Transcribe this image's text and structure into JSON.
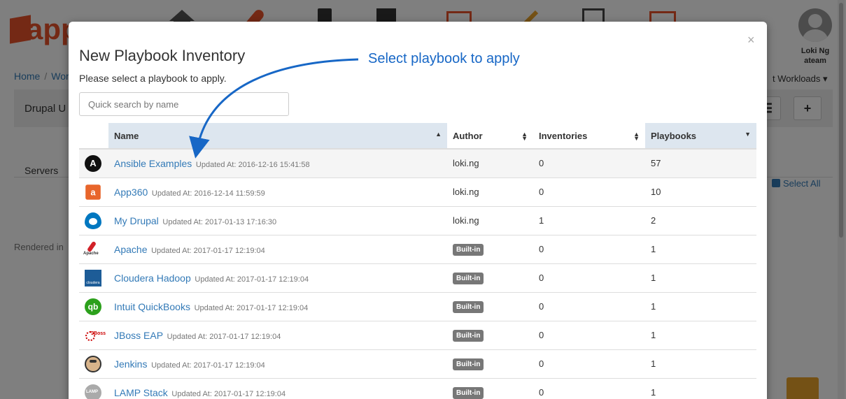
{
  "background": {
    "logo_text": "app",
    "user_name": "Loki Ng",
    "user_team": "ateam",
    "breadcrumb": [
      "Home",
      "Wor"
    ],
    "bar_title": "Drupal U",
    "workloads_label": "t Workloads",
    "list_button": "☰",
    "add_button": "+",
    "servers_label": "Servers",
    "select_all": "Select All",
    "rendered_text": "Rendered in"
  },
  "modal": {
    "close": "×",
    "title": "New Playbook Inventory",
    "subtitle": "Please select a playbook to apply.",
    "search_placeholder": "Quick search by name",
    "columns": {
      "name": "Name",
      "author": "Author",
      "inventories": "Inventories",
      "playbooks": "Playbooks"
    },
    "rows": [
      {
        "icon": "ansible-icon",
        "name": "Ansible Examples",
        "updated": "Updated At: 2016-12-16 15:41:58",
        "author": "loki.ng",
        "builtin": false,
        "inventories": "0",
        "playbooks": "57"
      },
      {
        "icon": "app360-icon",
        "name": "App360",
        "updated": "Updated At: 2016-12-14 11:59:59",
        "author": "loki.ng",
        "builtin": false,
        "inventories": "0",
        "playbooks": "10"
      },
      {
        "icon": "drupal-icon",
        "name": "My Drupal",
        "updated": "Updated At: 2017-01-13 17:16:30",
        "author": "loki.ng",
        "builtin": false,
        "inventories": "1",
        "playbooks": "2"
      },
      {
        "icon": "apache-icon",
        "name": "Apache",
        "updated": "Updated At: 2017-01-17 12:19:04",
        "author": "Built-in",
        "builtin": true,
        "inventories": "0",
        "playbooks": "1"
      },
      {
        "icon": "cloudera-icon",
        "name": "Cloudera Hadoop",
        "updated": "Updated At: 2017-01-17 12:19:04",
        "author": "Built-in",
        "builtin": true,
        "inventories": "0",
        "playbooks": "1"
      },
      {
        "icon": "quickbooks-icon",
        "name": "Intuit QuickBooks",
        "updated": "Updated At: 2017-01-17 12:19:04",
        "author": "Built-in",
        "builtin": true,
        "inventories": "0",
        "playbooks": "1"
      },
      {
        "icon": "jboss-icon",
        "name": "JBoss EAP",
        "updated": "Updated At: 2017-01-17 12:19:04",
        "author": "Built-in",
        "builtin": true,
        "inventories": "0",
        "playbooks": "1"
      },
      {
        "icon": "jenkins-icon",
        "name": "Jenkins",
        "updated": "Updated At: 2017-01-17 12:19:04",
        "author": "Built-in",
        "builtin": true,
        "inventories": "0",
        "playbooks": "1"
      },
      {
        "icon": "lamp-icon",
        "name": "LAMP Stack",
        "updated": "Updated At: 2017-01-17 12:19:04",
        "author": "Built-in",
        "builtin": true,
        "inventories": "0",
        "playbooks": "1"
      }
    ]
  },
  "annotation": {
    "text": "Select playbook to apply",
    "color": "#1767c6"
  },
  "colors": {
    "link": "#337ab7",
    "brand": "#e8532b",
    "badge": "#777777",
    "sorted_header": "#dde6ef"
  }
}
